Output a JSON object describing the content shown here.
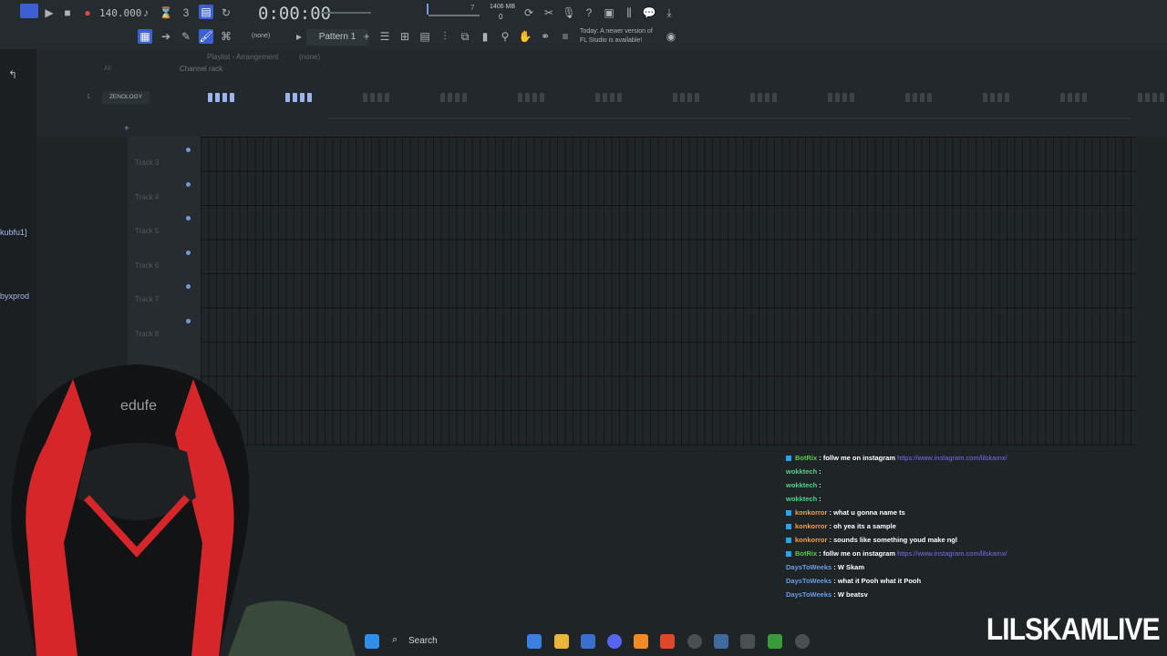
{
  "transport": {
    "tempo": "140.000",
    "time": "0:00:00",
    "memory": "1406 MB",
    "cpu_line": "0",
    "cpu_top": "7"
  },
  "toolbar2": {
    "snap": "(none)",
    "pattern": "Pattern 1",
    "news_line1": "Today: A newer version of",
    "news_line2": "FL Studio is available!"
  },
  "playlist": {
    "breadcrumb": "Playlist - Arrangement",
    "breadcrumb_pattern": "(none)",
    "channel_rack": "Channel rack",
    "all_label": "All",
    "channel_num": "1",
    "channel_name": "ZENOLOGY"
  },
  "tracks": [
    "Track 3",
    "Track 4",
    "Track 5",
    "Track 6",
    "Track 7",
    "Track 8"
  ],
  "side": {
    "user1": "kubfu1]",
    "user2": "byxprod"
  },
  "chat": [
    {
      "user": "BotRix",
      "text": ": follw me on instagram",
      "link": "https://www.instagram.com/lilskamx/",
      "user_color": "#59c94a",
      "badge": true
    },
    {
      "user": "wokktech",
      "text": ":",
      "link": "",
      "user_color": "#4fd18b",
      "badge": false
    },
    {
      "user": "wokktech",
      "text": ":",
      "link": "",
      "user_color": "#4fd18b",
      "badge": false
    },
    {
      "user": "wokktech",
      "text": ":",
      "link": "",
      "user_color": "#4fd18b",
      "badge": false
    },
    {
      "user": "konkorror",
      "text": ": what u gonna name ts",
      "link": "",
      "user_color": "#f2a04a",
      "badge": true
    },
    {
      "user": "konkorror",
      "text": ": oh yea its a sample",
      "link": "",
      "user_color": "#f2a04a",
      "badge": true
    },
    {
      "user": "konkorror",
      "text": ": sounds like something youd make ngl",
      "link": "",
      "user_color": "#f2a04a",
      "badge": true
    },
    {
      "user": "BotRix",
      "text": ": follw me on instagram",
      "link": "https://www.instagram.com/lilskamx/",
      "user_color": "#59c94a",
      "badge": true
    },
    {
      "user": "DaysToWeeks",
      "text": ": W Skam",
      "link": "",
      "user_color": "#6b9de8",
      "badge": false
    },
    {
      "user": "DaysToWeeks",
      "text": ": what it Pooh what it Pooh",
      "link": "",
      "user_color": "#6b9de8",
      "badge": false
    },
    {
      "user": "DaysToWeeks",
      "text": ": W beatsv",
      "link": "",
      "user_color": "#6b9de8",
      "badge": false
    }
  ],
  "taskbar": {
    "search_label": "Search"
  },
  "overlay": {
    "title": "LILSKAMLIVE"
  },
  "colors": {
    "accent": "#5e7de8",
    "pattern_block": "#9db4f0",
    "chair_red": "#d6262a"
  }
}
